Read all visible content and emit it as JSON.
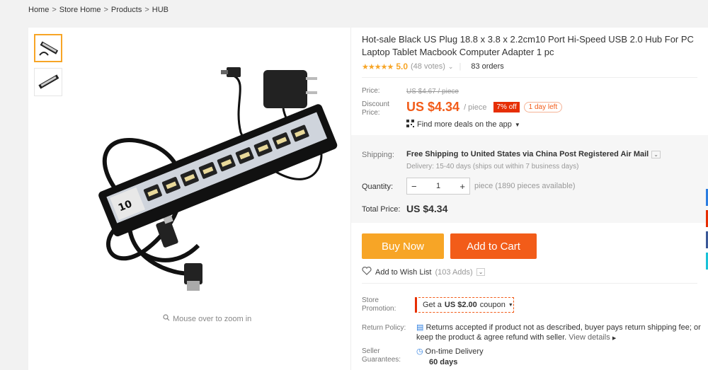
{
  "breadcrumb": [
    "Home",
    "Store Home",
    "Products",
    "HUB"
  ],
  "gallery": {
    "zoom_hint": "Mouse over to zoom in"
  },
  "product": {
    "title": "Hot-sale Black US Plug 18.8 x 3.8 x 2.2cm10 Port Hi-Speed USB 2.0 Hub For PC Laptop Tablet Macbook Computer Adapter 1 pc",
    "rating": "5.0",
    "votes": "(48 votes)",
    "orders": "83 orders",
    "stars": "★★★★★"
  },
  "price": {
    "label": "Price:",
    "old": "US $4.67 / piece",
    "discount_label_1": "Discount",
    "discount_label_2": "Price:",
    "current": "US $4.34",
    "unit": "/ piece",
    "off": "7% off",
    "timer": "1 day left",
    "deals": "Find more deals on the app"
  },
  "shipping": {
    "label": "Shipping:",
    "text_bold": "Free Shipping",
    "text_rest": "to United States via China Post Registered Air Mail",
    "delivery": "Delivery: 15-40 days (ships out within 7 business days)",
    "qty_label": "Quantity:",
    "qty_value": "1",
    "minus": "−",
    "plus": "+",
    "available": "piece (1890 pieces available)",
    "total_label": "Total Price:",
    "total": "US $4.34"
  },
  "actions": {
    "buy_now": "Buy Now",
    "add_to_cart": "Add to Cart",
    "wishlist": "Add to Wish List",
    "wishlist_count": "(103 Adds)"
  },
  "store": {
    "promo_label_1": "Store",
    "promo_label_2": "Promotion:",
    "coupon_prefix": "Get a",
    "coupon_amount": "US $2.00",
    "coupon_suffix": "coupon",
    "return_label": "Return Policy:",
    "return_text": "Returns accepted if product not as described, buyer pays return shipping fee; or keep the product & agree refund with seller.",
    "return_link": "View details",
    "guar_label_1": "Seller",
    "guar_label_2": "Guarantees:",
    "guar_title": "On-time Delivery",
    "guar_days": "60 days"
  },
  "colors": {
    "accent": "#f25c19",
    "buy": "#f7a526",
    "badge": "#e62e04"
  }
}
